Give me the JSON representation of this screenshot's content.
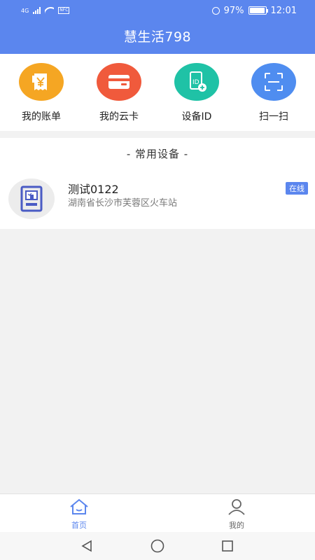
{
  "status_bar": {
    "network": "4G",
    "nfc": "NFC",
    "battery": "97%",
    "battery_level": 0.97,
    "time": "12:01"
  },
  "header": {
    "title": "慧生活798"
  },
  "quick_actions": [
    {
      "label": "我的账单",
      "icon": "receipt-yen-icon",
      "color": "#f5a623"
    },
    {
      "label": "我的云卡",
      "icon": "credit-card-icon",
      "color": "#f05a3c"
    },
    {
      "label": "设备ID",
      "icon": "device-id-icon",
      "color": "#1fc2a6"
    },
    {
      "label": "扫一扫",
      "icon": "scan-icon",
      "color": "#4f8df0"
    }
  ],
  "devices_section": {
    "title": "- 常用设备 -",
    "devices": [
      {
        "name": "测试0122",
        "location": "湖南省长沙市芙蓉区火车站",
        "status": "在线"
      }
    ]
  },
  "tabbar": {
    "home": {
      "label": "首页",
      "active": true
    },
    "mine": {
      "label": "我的",
      "active": false
    }
  },
  "colors": {
    "primary": "#5b86ee",
    "background": "#f2f2f2"
  }
}
